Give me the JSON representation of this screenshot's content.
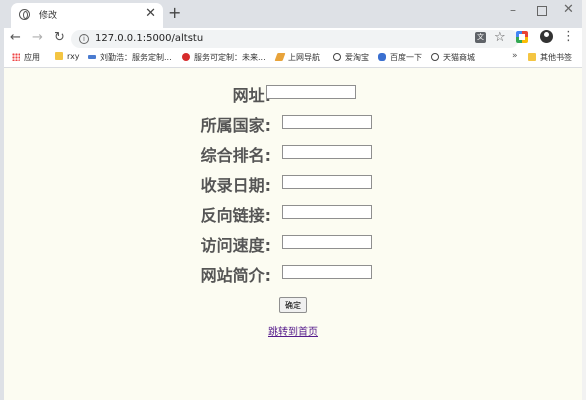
{
  "browser": {
    "tab_title": "修改",
    "tab_close": "✕",
    "new_tab": "+",
    "url": "127.0.0.1:5000/altstu",
    "translate_label": "文",
    "window_controls": {
      "minimize": "–",
      "close": "✕"
    },
    "bookmarks": [
      {
        "label": "应用",
        "icon": "apps-grid-icon"
      },
      {
        "label": "rxy",
        "icon": "folder-icon"
      },
      {
        "label": "刘勤浩：服务定制...",
        "icon": "site-icon"
      },
      {
        "label": "服务可定制：未来...",
        "icon": "huawei-icon"
      },
      {
        "label": "上网导航",
        "icon": "nav-icon"
      },
      {
        "label": "爱淘宝",
        "icon": "globe-icon"
      },
      {
        "label": "百度一下",
        "icon": "baidu-paw-icon"
      },
      {
        "label": "天猫商城",
        "icon": "globe-icon"
      }
    ],
    "bookmarks_more": "»",
    "other_bookmarks": "其他书签"
  },
  "form": {
    "fields": [
      {
        "label": "网址:",
        "value": ""
      },
      {
        "label": "所属国家:",
        "value": ""
      },
      {
        "label": "综合排名:",
        "value": ""
      },
      {
        "label": "收录日期:",
        "value": ""
      },
      {
        "label": "反向链接:",
        "value": ""
      },
      {
        "label": "访问速度:",
        "value": ""
      },
      {
        "label": "网站简介:",
        "value": ""
      }
    ],
    "submit_label": "确定",
    "home_link": "跳转到首页"
  }
}
